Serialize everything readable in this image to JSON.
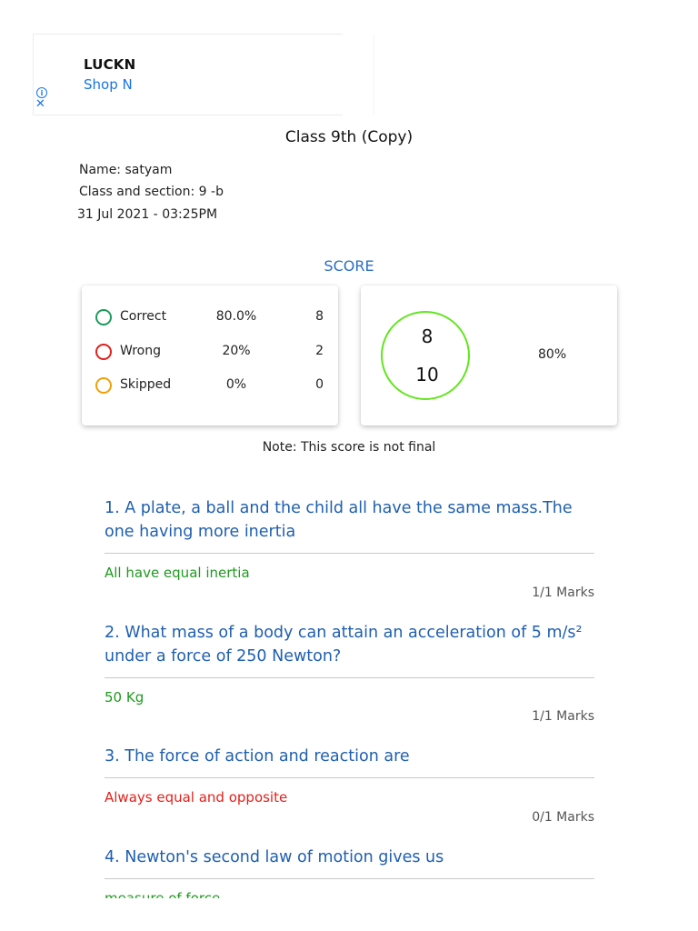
{
  "ad": {
    "title": "LUCKN",
    "link": "Shop N",
    "info_icon": "ⓘ",
    "close_icon": "✕"
  },
  "quiz": {
    "title": "Class 9th (Copy)",
    "name": "Name: satyam",
    "class_section": "Class and section: 9 -b",
    "date": "31 Jul 2021 - 03:25PM"
  },
  "score": {
    "label": "SCORE",
    "rows": [
      {
        "label": "Correct",
        "percent": "80.0%",
        "count": "8",
        "color": "#1a9c5b"
      },
      {
        "label": "Wrong",
        "percent": "20%",
        "count": "2",
        "color": "#e3211c"
      },
      {
        "label": "Skipped",
        "percent": "0%",
        "count": "0",
        "color": "#f2a100"
      }
    ],
    "obtained": "8",
    "total": "10",
    "percent": "80%",
    "circle_color": "#62e51e",
    "note": "Note: This score is not final"
  },
  "questions": [
    {
      "text": "1. A plate, a ball and the child all have the same mass.The one having more  inertia",
      "answer": "All have equal inertia",
      "correct": true,
      "marks": "1/1 Marks"
    },
    {
      "text": "2. What mass of a body can attain an acceleration of 5 m/s² under a force of 250 Newton?",
      "answer": "50 Kg",
      "correct": true,
      "marks": "1/1 Marks"
    },
    {
      "text": "3. The force of action and reaction are",
      "answer": "Always equal and opposite",
      "correct": false,
      "marks": "0/1 Marks"
    },
    {
      "text": "4. Newton's second law of motion gives us",
      "answer": "measure of force",
      "correct": true,
      "marks": ""
    }
  ],
  "colors": {
    "question": "#1f5fb0",
    "correct_answer": "#1f9a1f",
    "wrong_answer": "#e3211c",
    "score_label": "#2a6fc4"
  }
}
